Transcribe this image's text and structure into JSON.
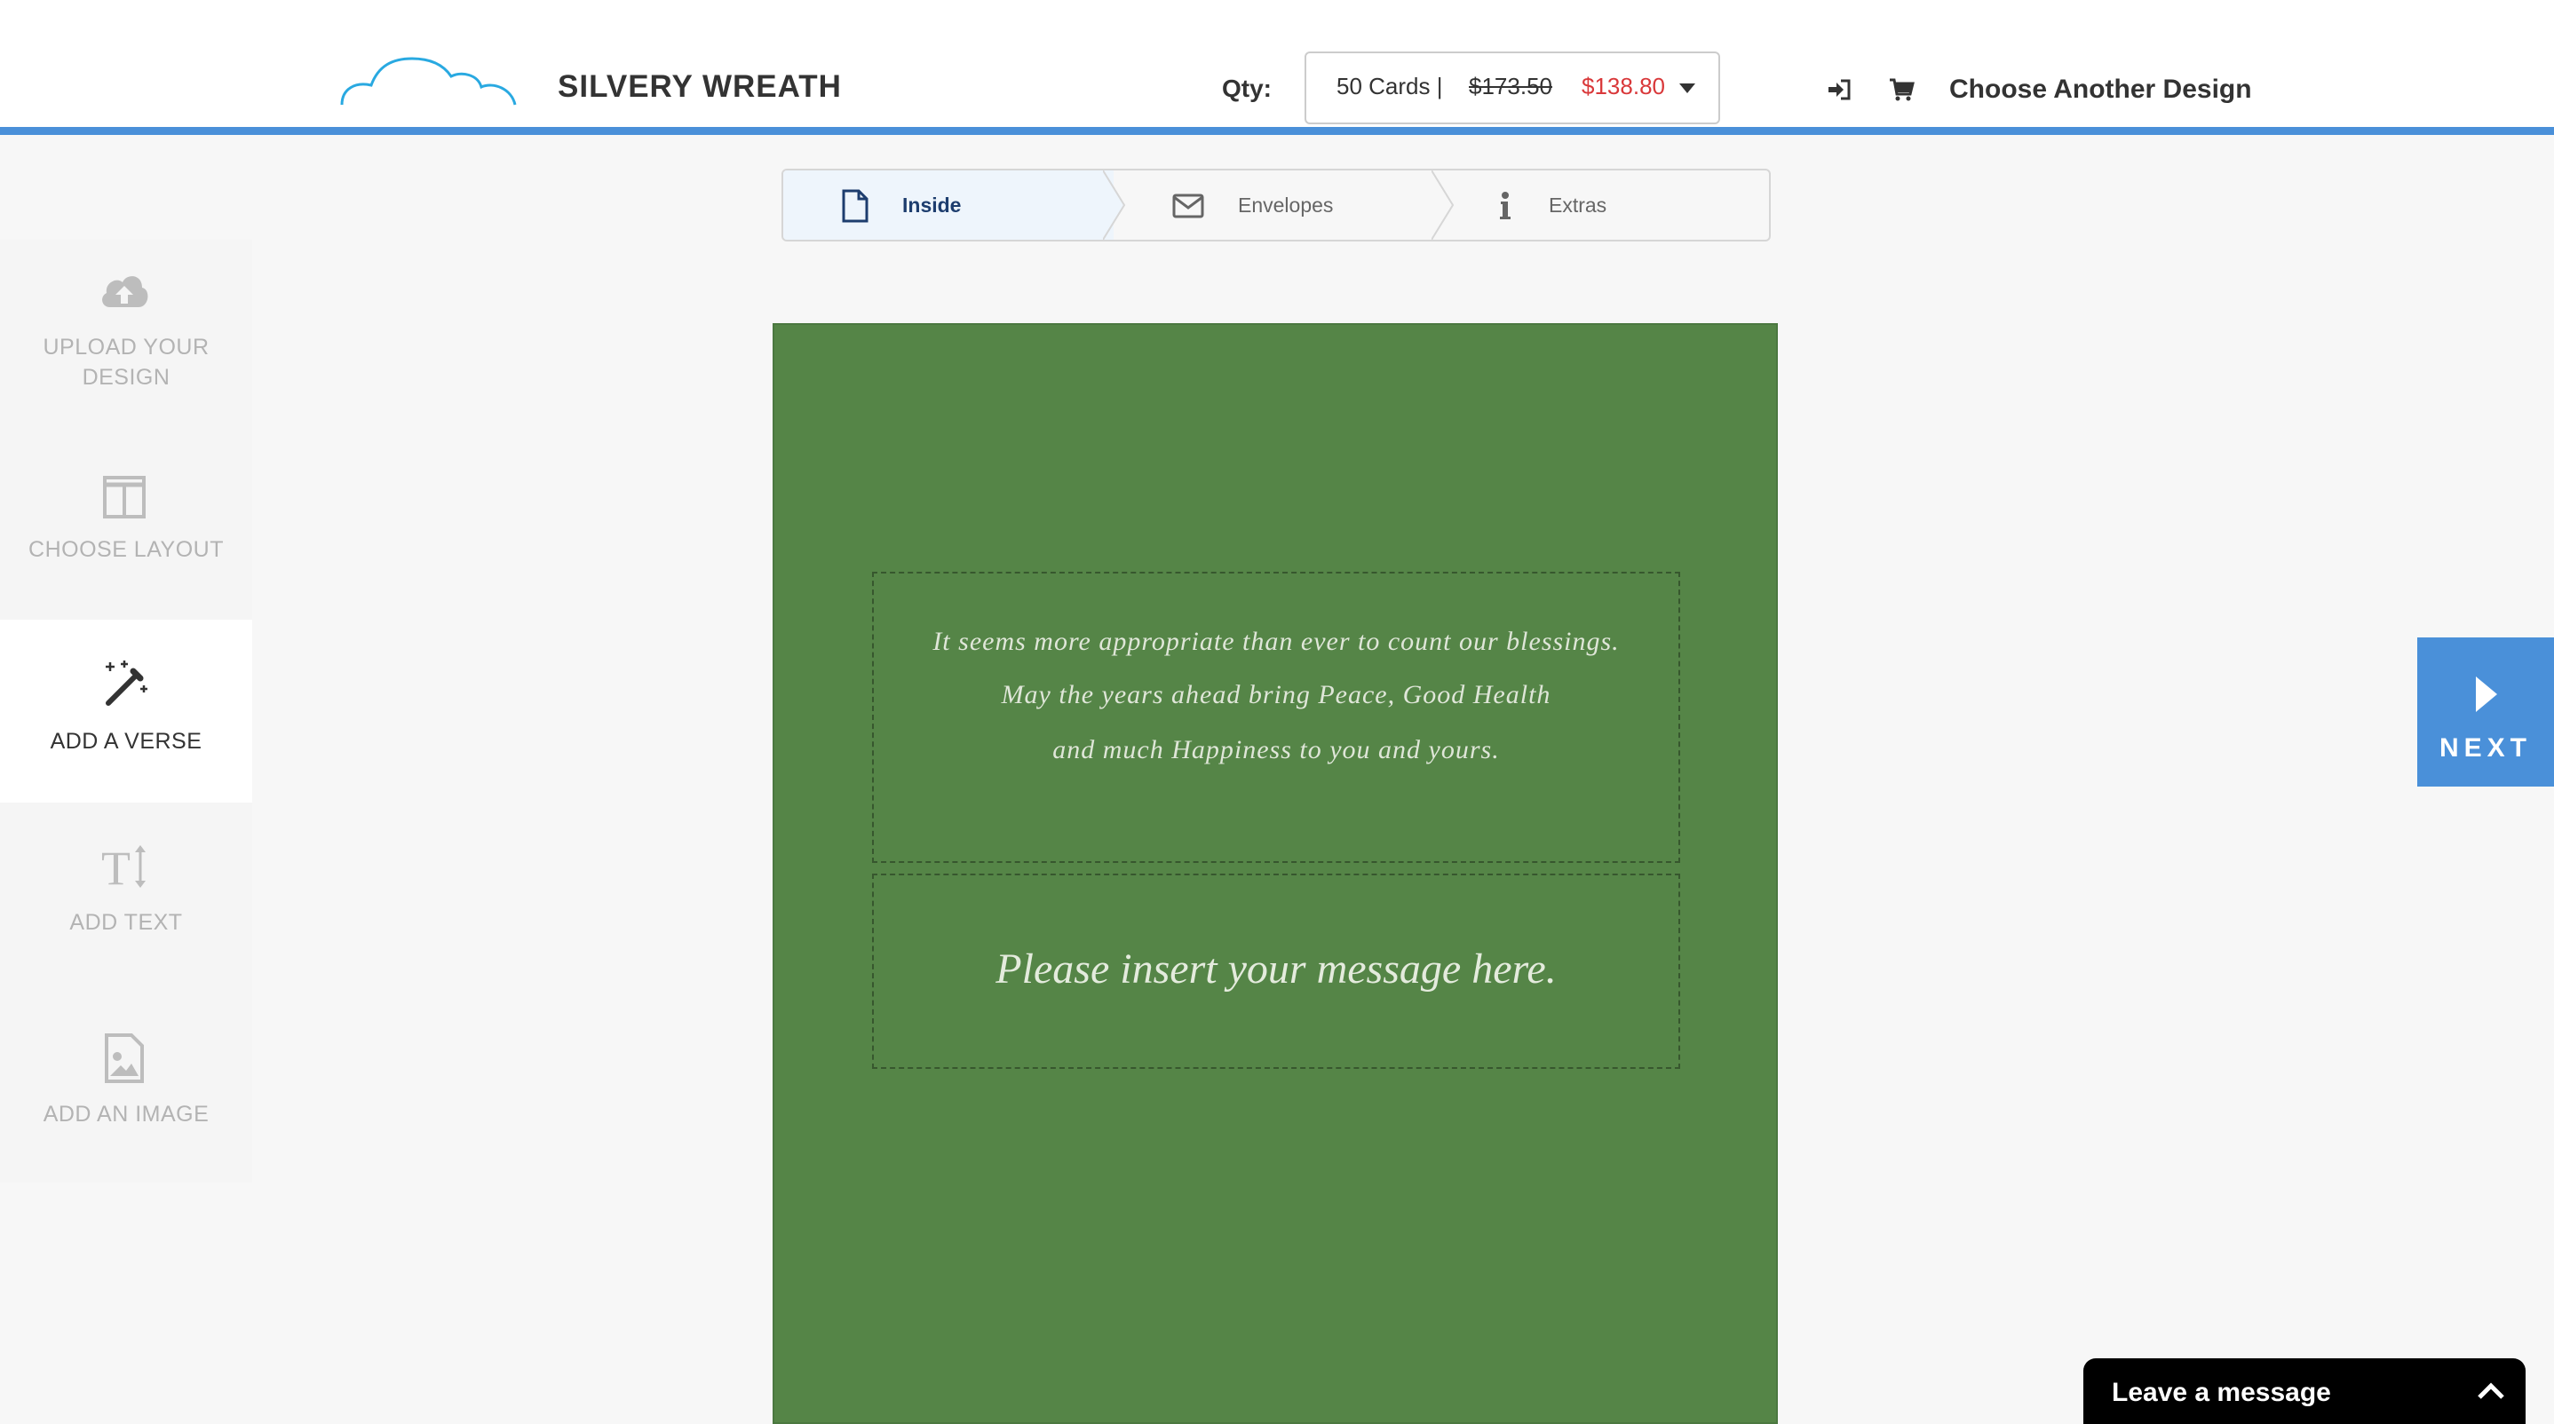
{
  "header": {
    "title": "SILVERY WREATH",
    "qty_label": "Qty:",
    "qty_cards": "50 Cards |",
    "qty_old_price": "$173.50",
    "qty_new_price": "$138.80",
    "choose_another": "Choose Another Design"
  },
  "steps": [
    {
      "label": "Inside",
      "icon": "document-icon",
      "active": true
    },
    {
      "label": "Envelopes",
      "icon": "envelope-icon",
      "active": false
    },
    {
      "label": "Extras",
      "icon": "info-icon",
      "active": false
    }
  ],
  "sidebar": {
    "items": [
      {
        "label_line1": "UPLOAD YOUR",
        "label_line2": "DESIGN",
        "icon": "cloud-upload-icon"
      },
      {
        "label": "CHOOSE LAYOUT",
        "icon": "layout-icon"
      },
      {
        "label": "ADD A VERSE",
        "icon": "magic-wand-icon",
        "active": true
      },
      {
        "label": "ADD TEXT",
        "icon": "text-icon"
      },
      {
        "label": "ADD AN IMAGE",
        "icon": "image-icon"
      }
    ]
  },
  "card": {
    "verse_lines": [
      "It seems more appropriate than ever to count our blessings.",
      "May the years ahead bring Peace, Good Health",
      "and much Happiness to you and yours."
    ],
    "message": "Please insert your message here."
  },
  "next_label": "NEXT",
  "chat_label": "Leave a message",
  "colors": {
    "accent": "#4a90d9",
    "card_green": "#558547",
    "price_red": "#d9383a"
  }
}
